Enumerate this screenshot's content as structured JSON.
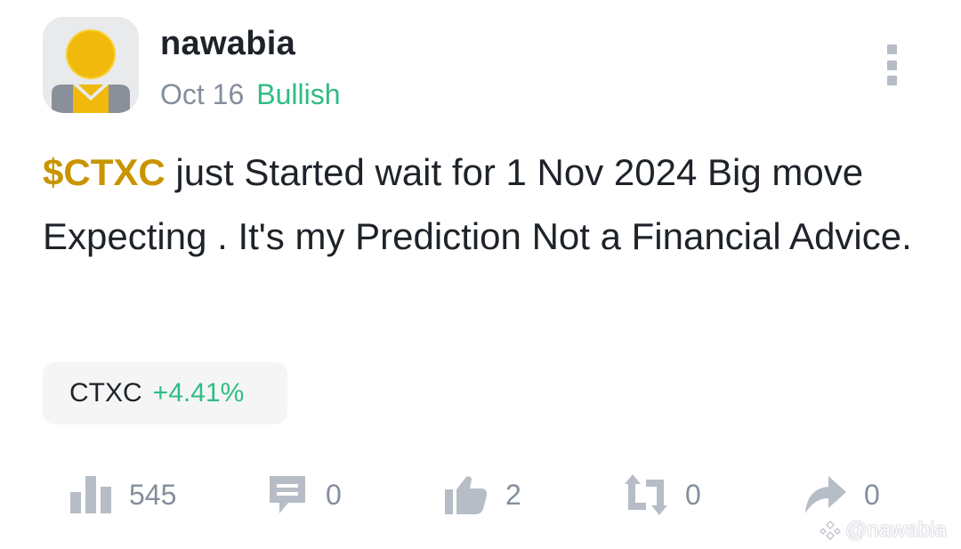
{
  "post": {
    "author": "nawabia",
    "date": "Oct 16",
    "sentiment": "Bullish",
    "ticker": "$CTXC",
    "body": " just Started wait for 1 Nov 2024 Big move Expecting . It's my Prediction Not a Financial Advice."
  },
  "coin_chip": {
    "symbol": "CTXC",
    "change": "+4.41%"
  },
  "stats": {
    "views": "545",
    "comments": "0",
    "likes": "2",
    "reposts": "0",
    "shares": "0"
  },
  "watermark": {
    "handle": "@nawabia"
  },
  "colors": {
    "ticker": "#c99400",
    "positive": "#2ebd85",
    "muted": "#848e9c",
    "icon": "#b7bdc6",
    "avatar_head": "#f0b90b",
    "avatar_body": "#8a9099"
  }
}
